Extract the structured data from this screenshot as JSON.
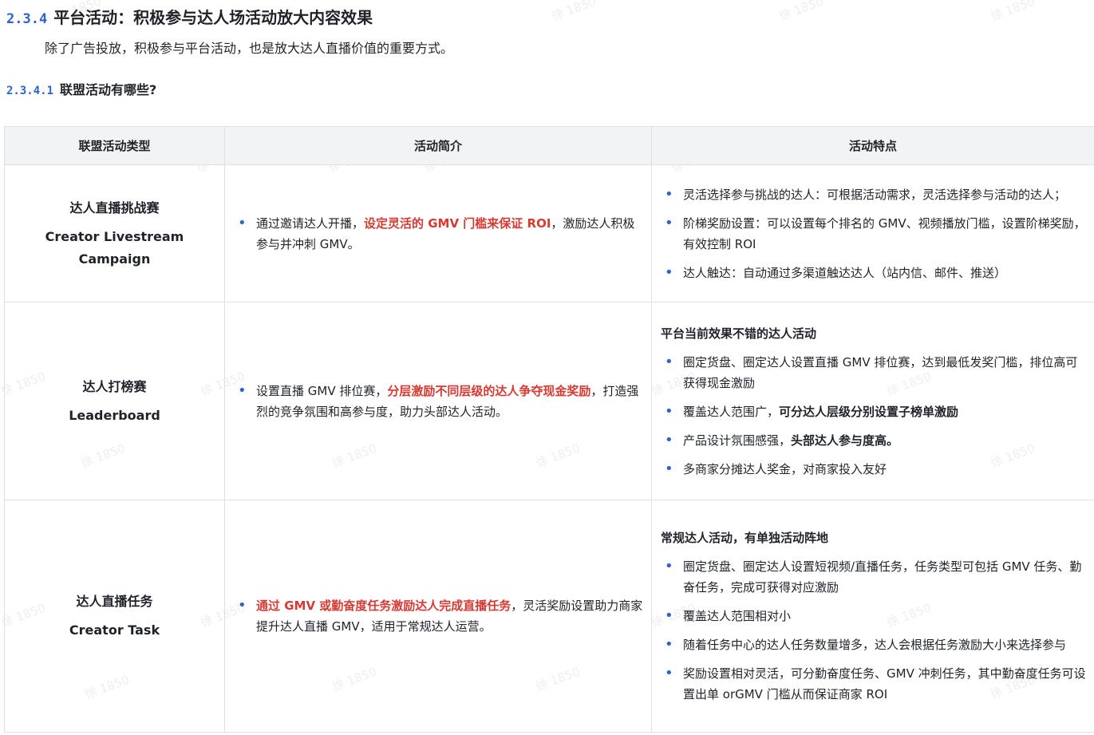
{
  "watermark": "徐 1850",
  "section": {
    "number": "2.3.4",
    "title": "平台活动：积极参与达人场活动放大内容效果",
    "intro": "除了广告投放，积极参与平台活动，也是放大达人直播价值的重要方式。"
  },
  "subsection": {
    "number": "2.3.4.1",
    "title": "联盟活动有哪些?"
  },
  "table": {
    "headers": [
      "联盟活动类型",
      "活动简介",
      "活动特点"
    ],
    "rows": [
      {
        "type_cn": "达人直播挑战赛",
        "type_en": "Creator Livestream Campaign",
        "intro": {
          "pre": "通过邀请达人开播，",
          "highlight": "设定灵活的 GMV 门槛来保证 ROI",
          "post": "，激励达人积极参与并冲刺 GMV。"
        },
        "feature_title": "",
        "features": [
          {
            "text": "灵活选择参与挑战的达人：可根据活动需求，灵活选择参与活动的达人；",
            "bold": ""
          },
          {
            "text": "阶梯奖励设置：可以设置每个排名的 GMV、视频播放门槛，设置阶梯奖励，有效控制 ROI",
            "bold": ""
          },
          {
            "text": "达人触达：自动通过多渠道触达达人（站内信、邮件、推送）",
            "bold": ""
          }
        ]
      },
      {
        "type_cn": "达人打榜赛",
        "type_en": "Leaderboard",
        "intro": {
          "pre": "设置直播 GMV 排位赛，",
          "highlight": "分层激励不同层级的达人争夺现金奖励",
          "post": "，打造强烈的竞争氛围和高参与度，助力头部达人活动。"
        },
        "feature_title": "平台当前效果不错的达人活动",
        "features": [
          {
            "text": "圈定货盘、圈定达人设置直播 GMV 排位赛，达到最低发奖门槛，排位高可获得现金激励",
            "bold": ""
          },
          {
            "text": "覆盖达人范围广，",
            "bold": "可分达人层级分别设置子榜单激励"
          },
          {
            "text": "产品设计氛围感强，",
            "bold": "头部达人参与度高。"
          },
          {
            "text": "多商家分摊达人奖金，对商家投入友好",
            "bold": ""
          }
        ]
      },
      {
        "type_cn": "达人直播任务",
        "type_en": "Creator Task",
        "intro": {
          "pre": "",
          "highlight": "通过 GMV 或勤奋度任务激励达人完成直播任务",
          "post": "，灵活奖励设置助力商家提升达人直播 GMV，适用于常规达人运营。"
        },
        "feature_title": "常规达人活动，有单独活动阵地",
        "features": [
          {
            "text": "圈定货盘、圈定达人设置短视频/直播任务，任务类型可包括 GMV 任务、勤奋任务，完成可获得对应激励",
            "bold": ""
          },
          {
            "text": "覆盖达人范围相对小",
            "bold": ""
          },
          {
            "text": "随着任务中心的达人任务数量增多，达人会根据任务激励大小来选择参与",
            "bold": ""
          },
          {
            "text": "奖励设置相对灵活，可分勤奋度任务、GMV 冲刺任务，其中勤奋度任务可设置出单 orGMV 门槛从而保证商家 ROI",
            "bold": ""
          }
        ]
      }
    ]
  },
  "colors": {
    "accent_blue": "#2a63d6",
    "highlight_red": "#d83931",
    "header_bg": "#f2f3f5",
    "border": "#dee0e3"
  }
}
